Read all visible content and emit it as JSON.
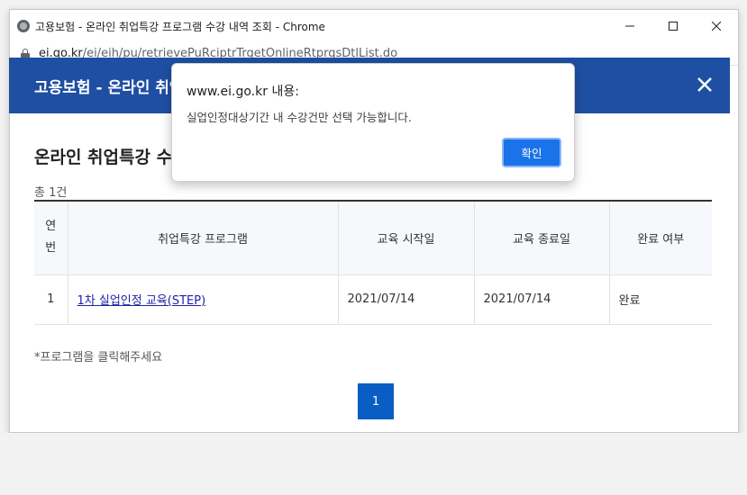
{
  "window": {
    "title": "고용보험 - 온라인 취업특강 프로그램 수강 내역 조회 - Chrome",
    "url_host": "ei.go.kr",
    "url_path": "/ei/eih/pu/retrievePuRciptrTrgetOnlineRtprgsDtlList.do",
    "minimize_icon": "minimize-icon",
    "maximize_icon": "maximize-icon",
    "close_icon": "close-icon"
  },
  "header": {
    "title": "고용보험 - 온라인 취업특강 수강 내역 조회",
    "background": "#1f4fa3"
  },
  "main": {
    "page_title": "온라인 취업특강 수강 내역 조회",
    "count_label": "총 1건",
    "columns": [
      "연번",
      "취업특강 프로그램",
      "교육 시작일",
      "교육 종료일",
      "완료 여부"
    ],
    "rows": [
      {
        "num": "1",
        "program": "1차 실업인정 교육(STEP)",
        "start": "2021/07/14",
        "end": "2021/07/14",
        "status": "완료"
      }
    ],
    "notice": "*프로그램을 클릭해주세요",
    "page_number": "1"
  },
  "dialog": {
    "title": "www.ei.go.kr 내용:",
    "message": "실업인정대상기간 내 수강건만 선택 가능합니다.",
    "ok_label": "확인",
    "accent": "#1a73e8"
  }
}
